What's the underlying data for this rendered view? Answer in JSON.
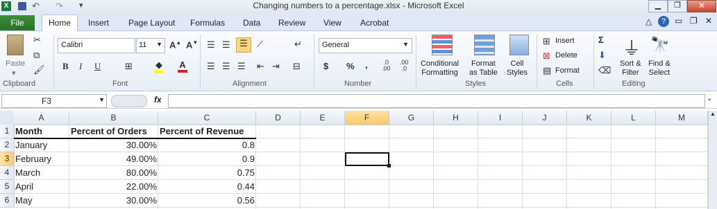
{
  "window": {
    "title": "Changing numbers to a percentage.xlsx  -  Microsoft Excel"
  },
  "tabs": [
    "File",
    "Home",
    "Insert",
    "Page Layout",
    "Formulas",
    "Data",
    "Review",
    "View",
    "Acrobat"
  ],
  "ribbon": {
    "clipboard": {
      "label": "Clipboard",
      "paste": "Paste"
    },
    "font": {
      "label": "Font",
      "name": "Calibri",
      "size": "11"
    },
    "alignment": {
      "label": "Alignment"
    },
    "number": {
      "label": "Number",
      "format": "General",
      "currency": "$",
      "percent": "%",
      "comma": ",",
      "inc_decimal": ".0\n.00",
      "dec_decimal": ".00\n.0"
    },
    "styles": {
      "label": "Styles",
      "conditional": "Conditional\nFormatting",
      "format_table": "Format\nas Table",
      "cell_styles": "Cell\nStyles"
    },
    "cells": {
      "label": "Cells",
      "insert": "Insert",
      "delete": "Delete",
      "format": "Format"
    },
    "editing": {
      "label": "Editing",
      "sort_filter": "Sort &\nFilter",
      "find_select": "Find &\nSelect"
    }
  },
  "formula_bar": {
    "name_box": "F3",
    "fx": "fx",
    "value": ""
  },
  "columns": [
    "A",
    "B",
    "C",
    "D",
    "E",
    "F",
    "G",
    "H",
    "I",
    "J",
    "K",
    "L",
    "M"
  ],
  "rows": [
    "1",
    "2",
    "3",
    "4",
    "5",
    "6"
  ],
  "sheet": {
    "headers": [
      "Month",
      "Percent of Orders",
      "Percent of Revenue"
    ],
    "data": [
      [
        "January",
        "30.00%",
        "0.8"
      ],
      [
        "February",
        "49.00%",
        "0.9"
      ],
      [
        "March",
        "80.00%",
        "0.75"
      ],
      [
        "April",
        "22.00%",
        "0.44"
      ],
      [
        "May",
        "30.00%",
        "0.56"
      ]
    ]
  },
  "selection": "F3"
}
